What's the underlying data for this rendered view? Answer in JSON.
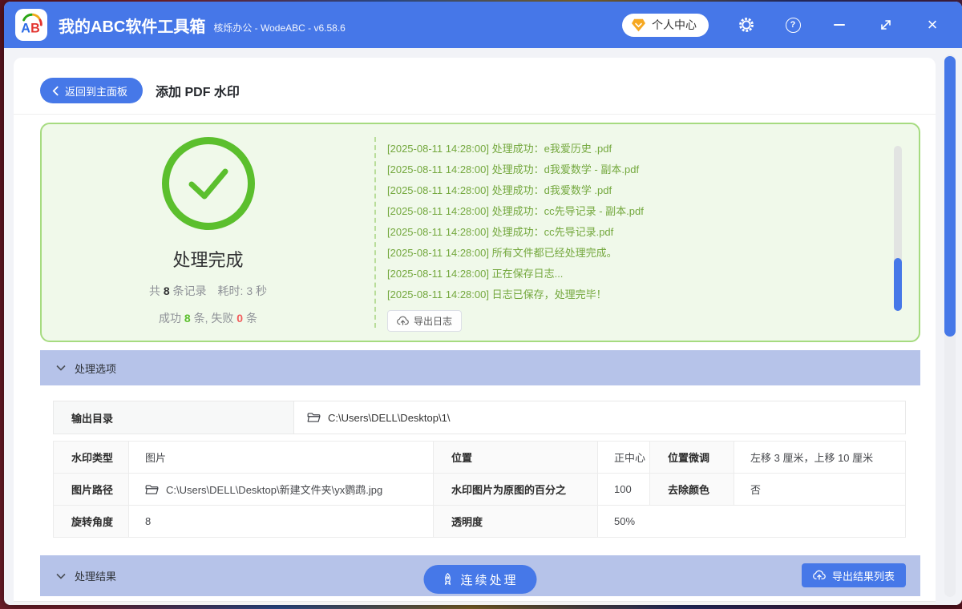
{
  "colors": {
    "accent_blue": "#4677e8",
    "header_lavender": "#b6c3e9",
    "success_green": "#5bbf2d",
    "panel_green_bg": "#f0f9ea",
    "panel_green_border": "#a6db80",
    "log_green": "#74a83e",
    "error_red": "#f25c5c"
  },
  "icons": {
    "logo": "ab-logo",
    "user_center": "gem-icon",
    "settings": "gear-icon",
    "help": "question-circle-icon",
    "minimize": "minus-icon",
    "resize": "diagonal-arrows-icon",
    "close": "x-icon",
    "back": "chevron-left-icon",
    "section": "chevron-down-icon",
    "status": "check-circle-icon",
    "folder": "open-folder-icon",
    "export": "cloud-upload-icon",
    "continue": "rocket-icon"
  },
  "titlebar": {
    "logo_a": "A",
    "logo_b": "B",
    "app_title": "我的ABC软件工具箱",
    "app_subtitle": "核烁办公 - WodeABC - v6.58.6",
    "user_center_label": "个人中心"
  },
  "header": {
    "back_label": "返回到主面板",
    "page_title": "添加 PDF 水印"
  },
  "result_panel": {
    "status_title": "处理完成",
    "stats_line1": [
      {
        "text": "共 ",
        "c": "gray"
      },
      {
        "text": "8",
        "c": "dark"
      },
      {
        "text": " 条记录",
        "c": "gray"
      },
      {
        "text": "　耗时: 3 秒",
        "c": "gray"
      }
    ],
    "stats_line2": [
      {
        "text": "成功 ",
        "c": "gray"
      },
      {
        "text": "8",
        "c": "green"
      },
      {
        "text": " 条, 失败 ",
        "c": "gray"
      },
      {
        "text": "0",
        "c": "red"
      },
      {
        "text": " 条",
        "c": "gray"
      }
    ],
    "log_lines": [
      "[2025-08-11 14:28:00] 处理成功：e我爱历史 .pdf",
      "[2025-08-11 14:28:00] 处理成功：d我爱数学 - 副本.pdf",
      "[2025-08-11 14:28:00] 处理成功：d我爱数学 .pdf",
      "[2025-08-11 14:28:00] 处理成功：cc先导记录 - 副本.pdf",
      "[2025-08-11 14:28:00] 处理成功：cc先导记录.pdf",
      "[2025-08-11 14:28:00] 所有文件都已经处理完成。",
      "[2025-08-11 14:28:00] 正在保存日志...",
      "[2025-08-11 14:28:00] 日志已保存，处理完毕！"
    ],
    "export_log_label": "导出日志"
  },
  "sections": {
    "options_label": "处理选项",
    "results_label": "处理结果"
  },
  "output_dir": {
    "label": "输出目录",
    "value": "C:\\Users\\DELL\\Desktop\\1\\"
  },
  "options_table": {
    "rows": [
      [
        {
          "t": "label",
          "text": "水印类型"
        },
        {
          "t": "value",
          "text": "图片"
        },
        {
          "t": "label",
          "text": "位置"
        },
        {
          "t": "value",
          "text": "正中心"
        },
        {
          "t": "label",
          "text": "位置微调"
        },
        {
          "t": "value",
          "text": "左移 3 厘米，上移 10 厘米"
        }
      ],
      [
        {
          "t": "label",
          "text": "图片路径"
        },
        {
          "t": "value",
          "text": "C:\\Users\\DELL\\Desktop\\新建文件夹\\yx鹦鹉.jpg",
          "icon": "folder"
        },
        {
          "t": "label",
          "text": "水印图片为原图的百分之"
        },
        {
          "t": "value",
          "text": "100"
        },
        {
          "t": "label",
          "text": "去除颜色"
        },
        {
          "t": "value",
          "text": "否"
        }
      ],
      [
        {
          "t": "label",
          "text": "旋转角度"
        },
        {
          "t": "value",
          "text": "8"
        },
        {
          "t": "label",
          "text": "透明度"
        },
        {
          "t": "value",
          "text": "50%",
          "colspan": 3
        }
      ]
    ]
  },
  "actions": {
    "continue_label": "连续处理",
    "export_results_label": "导出结果列表"
  }
}
